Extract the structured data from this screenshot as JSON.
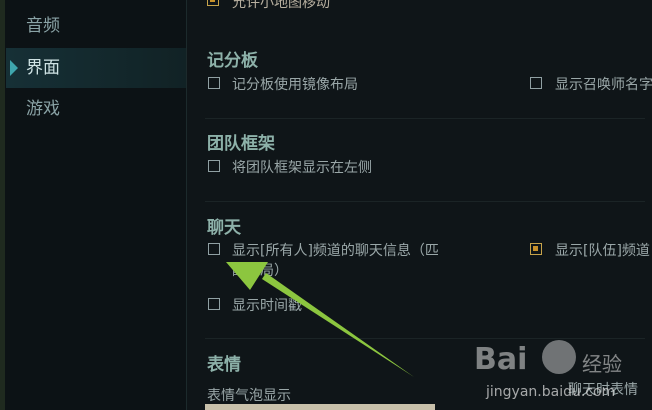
{
  "sidebar": {
    "items": [
      {
        "label": "音频"
      },
      {
        "label": "界面"
      },
      {
        "label": "游戏"
      }
    ],
    "active": "界面"
  },
  "main": {
    "top_option": "允许小地图移动",
    "sections": [
      {
        "title": "记分板",
        "options": [
          {
            "label": "记分板使用镜像布局",
            "checked": false
          },
          {
            "label": "显示召唤师名字",
            "checked": false
          }
        ]
      },
      {
        "title": "团队框架",
        "options": [
          {
            "label": "将团队框架显示在左侧",
            "checked": false
          }
        ]
      },
      {
        "title": "聊天",
        "options": [
          {
            "label_line1": "显示[所有人]频道的聊天信息（匹",
            "label_line2": "配对局）",
            "checked": false
          },
          {
            "label": "显示[队伍]频道",
            "checked": true
          },
          {
            "label": "显示时间戳",
            "checked": false
          }
        ]
      },
      {
        "title": "表情",
        "options": [
          {
            "label": "表情气泡显示"
          },
          {
            "label": "聊天时表情"
          }
        ]
      }
    ]
  },
  "watermark": {
    "brand": "Bai",
    "brand2": "经验",
    "url": "jingyan.baidu.com"
  },
  "colors": {
    "section_title": "#8db1a9",
    "text": "#9aa7a8",
    "accent_checkbox": "#c8912a",
    "arrow": "#8cc63f"
  }
}
